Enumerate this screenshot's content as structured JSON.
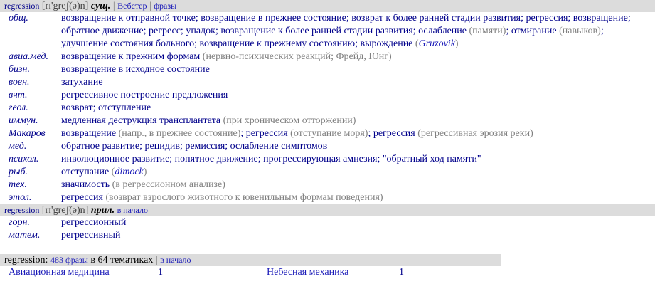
{
  "entry1": {
    "word": "regression",
    "transcription": "[rɪ'greʃ(ə)n]",
    "pos": "сущ.",
    "link_webster": "Вебстер",
    "link_phrases": "фразы",
    "rows": [
      {
        "subject": "общ.",
        "parts": [
          {
            "t": "возвращение к отправной точке; возвращение в прежнее состояние; возврат к более ранней стадии развития; регрессия; возвращение; обратное движение; регресс; упадок; возвращение к более ранней стадии развития; ослабление "
          },
          {
            "t": "(памяти)",
            "c": "gr"
          },
          {
            "t": "; отмирание "
          },
          {
            "t": "(навыков)",
            "c": "gr"
          },
          {
            "t": "; улучшение состояния больного; возвращение к прежнему состоянию; вырождение "
          },
          {
            "t": "(",
            "c": "gr"
          },
          {
            "t": "Gruzovik",
            "c": "au"
          },
          {
            "t": ")",
            "c": "gr"
          }
        ]
      },
      {
        "subject": "авиа.мед.",
        "parts": [
          {
            "t": "возвращение к прежним формам "
          },
          {
            "t": "(нервно-психических реакций; Фрейд, Юнг)",
            "c": "gr"
          }
        ]
      },
      {
        "subject": "бизн.",
        "parts": [
          {
            "t": "возвращение в исходное состояние"
          }
        ]
      },
      {
        "subject": "воен.",
        "parts": [
          {
            "t": "затухание"
          }
        ]
      },
      {
        "subject": "вчт.",
        "parts": [
          {
            "t": "регрессивное построение предложения"
          }
        ]
      },
      {
        "subject": "геол.",
        "parts": [
          {
            "t": "возврат; отступление"
          }
        ]
      },
      {
        "subject": "иммун.",
        "parts": [
          {
            "t": "медленная деструкция трансплантата "
          },
          {
            "t": "(при хроническом отторжении)",
            "c": "gr"
          }
        ]
      },
      {
        "subject": "Макаров",
        "parts": [
          {
            "t": "возвращение "
          },
          {
            "t": "(напр., в прежнее состояние)",
            "c": "gr"
          },
          {
            "t": "; регрессия "
          },
          {
            "t": "(отступание моря)",
            "c": "gr"
          },
          {
            "t": "; регрессия "
          },
          {
            "t": "(регрессивная эрозия реки)",
            "c": "gr"
          }
        ]
      },
      {
        "subject": "мед.",
        "parts": [
          {
            "t": "обратное развитие; рецидив; ремиссия; ослабление симптомов"
          }
        ]
      },
      {
        "subject": "психол.",
        "parts": [
          {
            "t": "инволюционное развитие; попятное движение; прогрессирующая амнезия; \"обратный ход памяти\""
          }
        ]
      },
      {
        "subject": "рыб.",
        "parts": [
          {
            "t": "отступание "
          },
          {
            "t": "(",
            "c": "gr"
          },
          {
            "t": "dimock",
            "c": "au"
          },
          {
            "t": ")",
            "c": "gr"
          }
        ]
      },
      {
        "subject": "тех.",
        "parts": [
          {
            "t": "значимость "
          },
          {
            "t": "(в регрессионном анализе)",
            "c": "gr"
          }
        ]
      },
      {
        "subject": "этол.",
        "parts": [
          {
            "t": "регрессия "
          },
          {
            "t": "(возврат взрослого животного к ювенильным формам поведения)",
            "c": "gr"
          }
        ]
      }
    ]
  },
  "entry2": {
    "word": "regression",
    "transcription": "[rɪ'greʃ(ə)n]",
    "pos": "прил.",
    "link_top": "в начало",
    "rows": [
      {
        "subject": "горн.",
        "parts": [
          {
            "t": "регрессионный"
          }
        ]
      },
      {
        "subject": "матем.",
        "parts": [
          {
            "t": "регрессивный"
          }
        ]
      }
    ]
  },
  "phrases": {
    "word": "regression:",
    "count": "483 фразы",
    "topics_text": "в 64 тематиках",
    "link_top": "в начало",
    "topics": [
      {
        "name": "Авиационная медицина",
        "count": "1",
        "name2": "Небесная механика",
        "count2": "1"
      }
    ]
  }
}
